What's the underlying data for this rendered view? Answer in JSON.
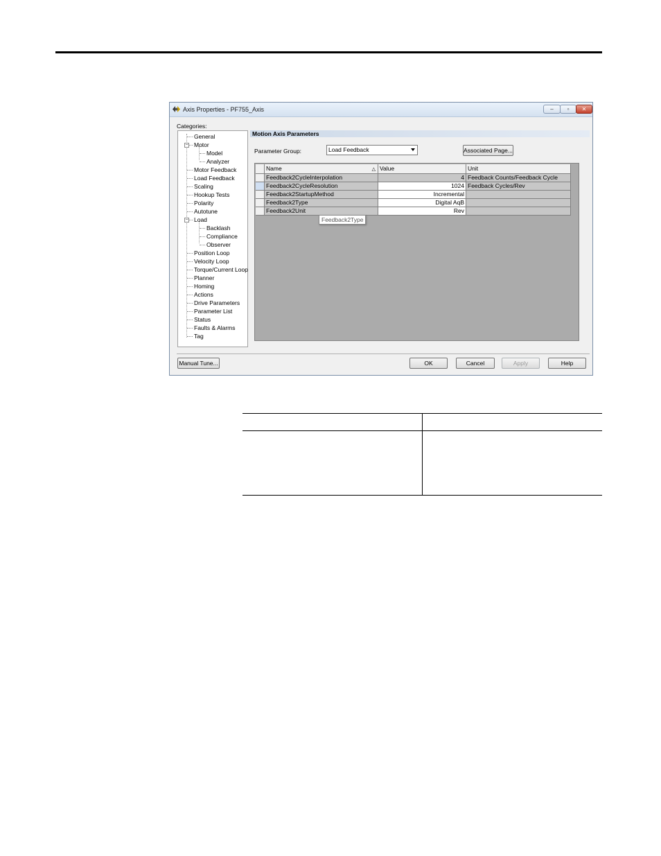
{
  "window": {
    "title": "Axis Properties - PF755_Axis",
    "controls": {
      "minimize": "–",
      "maximize": "▫",
      "close": "✕"
    }
  },
  "categories": {
    "label": "Categories:",
    "items": [
      {
        "label": "General",
        "level": 1
      },
      {
        "label": "Motor",
        "level": 1,
        "expanded": true
      },
      {
        "label": "Model",
        "level": 2
      },
      {
        "label": "Analyzer",
        "level": 2
      },
      {
        "label": "Motor Feedback",
        "level": 1
      },
      {
        "label": "Load Feedback",
        "level": 1
      },
      {
        "label": "Scaling",
        "level": 1
      },
      {
        "label": "Hookup Tests",
        "level": 1
      },
      {
        "label": "Polarity",
        "level": 1
      },
      {
        "label": "Autotune",
        "level": 1
      },
      {
        "label": "Load",
        "level": 1,
        "expanded": true
      },
      {
        "label": "Backlash",
        "level": 2
      },
      {
        "label": "Compliance",
        "level": 2
      },
      {
        "label": "Observer",
        "level": 2
      },
      {
        "label": "Position Loop",
        "level": 1
      },
      {
        "label": "Velocity Loop",
        "level": 1
      },
      {
        "label": "Torque/Current Loop",
        "level": 1
      },
      {
        "label": "Planner",
        "level": 1
      },
      {
        "label": "Homing",
        "level": 1
      },
      {
        "label": "Actions",
        "level": 1
      },
      {
        "label": "Drive Parameters",
        "level": 1
      },
      {
        "label": "Parameter List",
        "level": 1
      },
      {
        "label": "Status",
        "level": 1
      },
      {
        "label": "Faults & Alarms",
        "level": 1
      },
      {
        "label": "Tag",
        "level": 1
      }
    ]
  },
  "main": {
    "section_title": "Motion Axis Parameters",
    "parameter_group_label": "Parameter Group:",
    "parameter_group_value": "Load Feedback",
    "associated_page_button": "Associated Page...",
    "grid": {
      "columns": [
        "Name",
        "Value",
        "Unit"
      ],
      "rows": [
        {
          "name": "Feedback2CycleInterpolation",
          "value": "4",
          "unit": "Feedback Counts/Feedback Cycle"
        },
        {
          "name": "Feedback2CycleResolution",
          "value": "1024",
          "unit": "Feedback Cycles/Rev"
        },
        {
          "name": "Feedback2StartupMethod",
          "value": "Incremental",
          "unit": ""
        },
        {
          "name": "Feedback2Type",
          "value": "Digital AqB",
          "unit": ""
        },
        {
          "name": "Feedback2Unit",
          "value": "Rev",
          "unit": ""
        }
      ]
    },
    "tooltip": "Feedback2Type"
  },
  "footer": {
    "manual_tune": "Manual Tune...",
    "ok": "OK",
    "cancel": "Cancel",
    "apply": "Apply",
    "help": "Help"
  }
}
